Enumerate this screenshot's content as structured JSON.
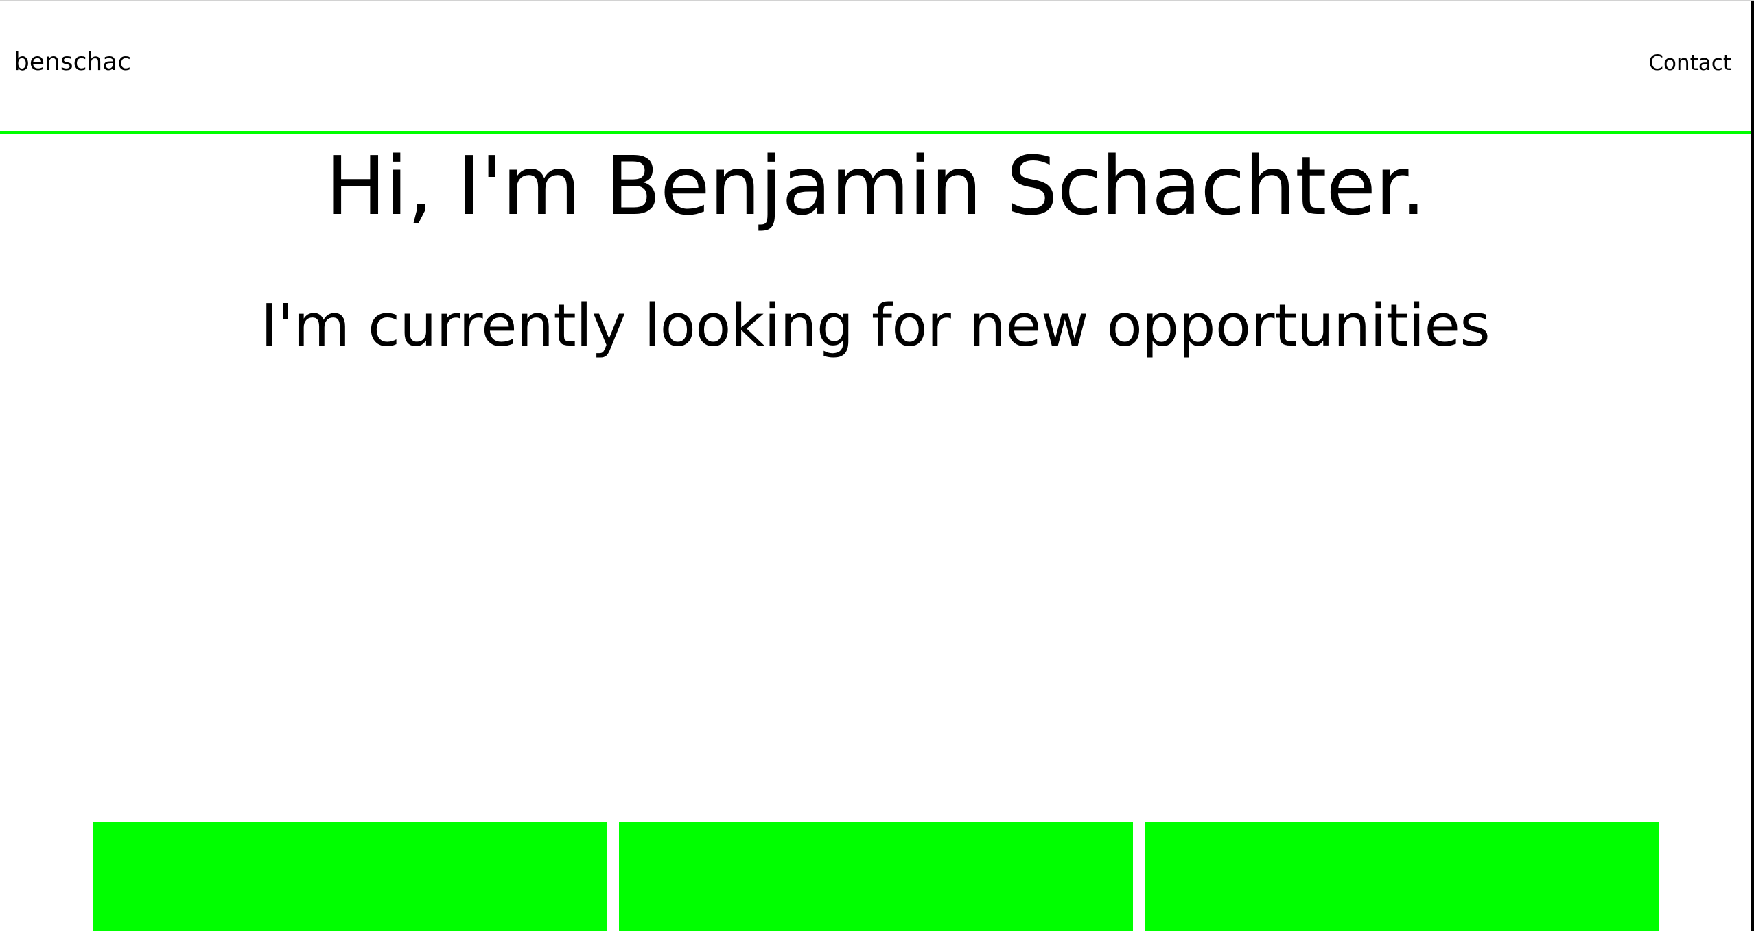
{
  "nav": {
    "brand": "benschac",
    "contact_label": "Contact"
  },
  "hero": {
    "title": "Hi, I'm Benjamin Schachter.",
    "subtitle": "I'm currently looking for new opportunities"
  },
  "cards": [
    {
      "label": ""
    },
    {
      "label": ""
    },
    {
      "label": ""
    }
  ],
  "colors": {
    "accent": "#00ff00",
    "text": "#000000",
    "background": "#ffffff"
  }
}
